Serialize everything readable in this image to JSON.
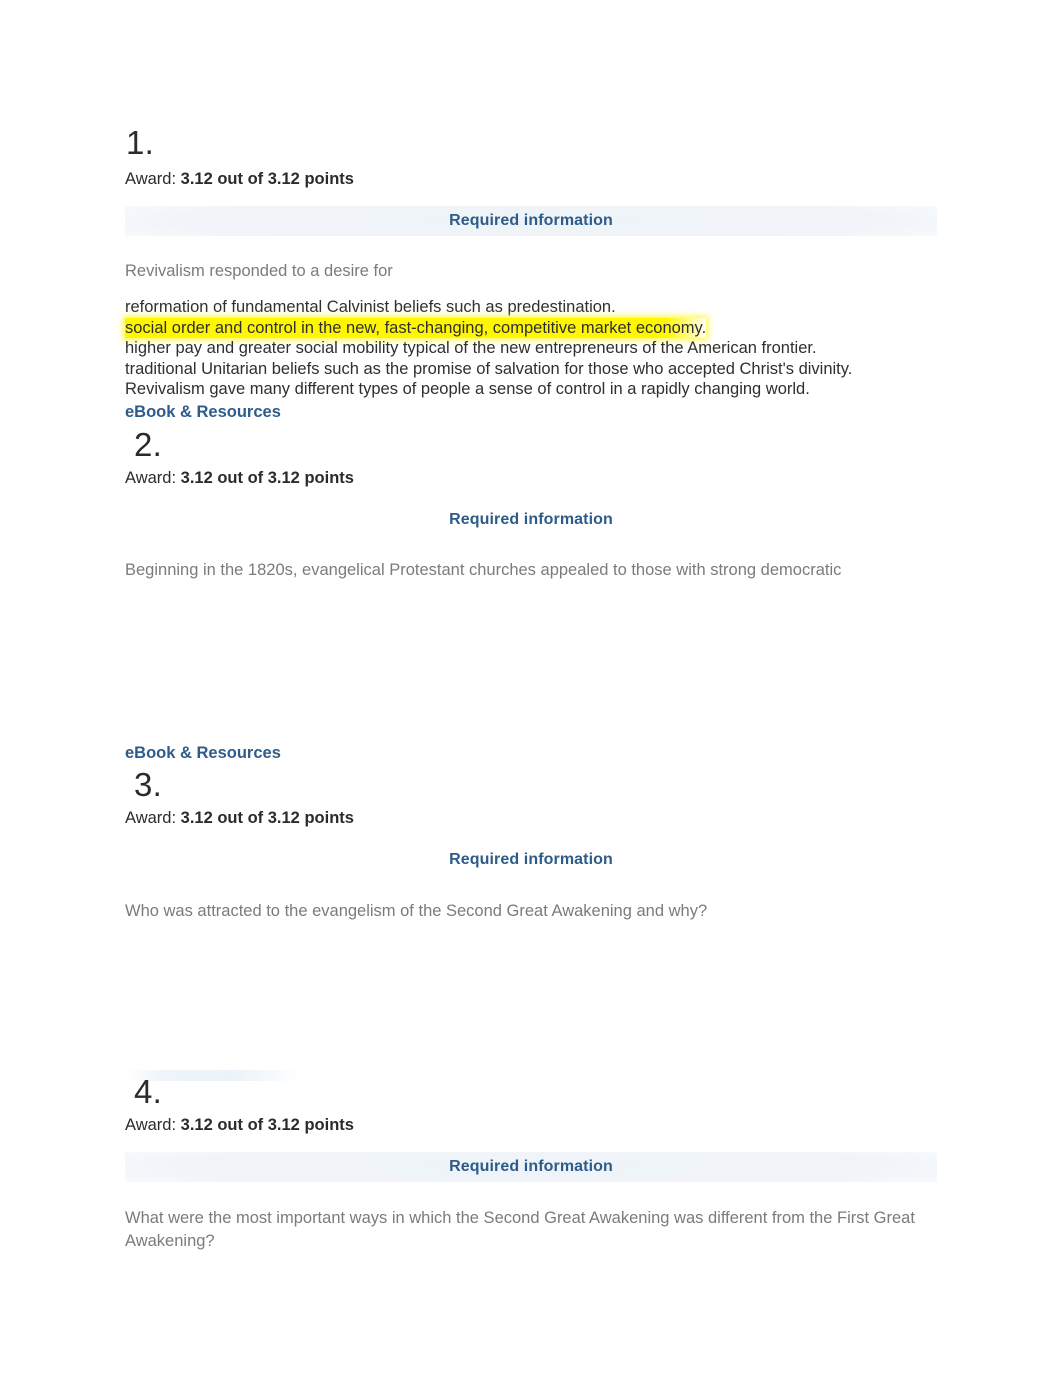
{
  "document": {
    "background_color": "#ffffff",
    "link_color": "#2e5c8a",
    "prompt_color": "#7b7b7b",
    "highlight_color": "#fff700"
  },
  "labels": {
    "award_label": "Award:",
    "required_information": "Required information",
    "ebook_resources": "eBook & Resources"
  },
  "questions": [
    {
      "number": "1.",
      "award_value": "3.12 out of 3.12 points",
      "required_information": "Required information",
      "prompt": "Revivalism responded to a desire for",
      "options": [
        {
          "text": "reformation of fundamental Calvinist beliefs such as predestination.",
          "highlighted": false
        },
        {
          "text": "social order and control in the new, fast-changing, competitive market economy.",
          "highlighted": true
        },
        {
          "text": "higher pay and greater social mobility typical of the new entrepreneurs of the American frontier.",
          "highlighted": false
        },
        {
          "text": "traditional Unitarian beliefs such as the promise of salvation for those who accepted Christ's divinity.",
          "highlighted": false
        },
        {
          "text": "Revivalism gave many different types of people a sense of control in a rapidly changing world.",
          "highlighted": false
        }
      ],
      "ebook_link": "eBook & Resources"
    },
    {
      "number": "2.",
      "award_value": "3.12 out of 3.12 points",
      "required_information": "Required information",
      "prompt": "Beginning in the 1820s, evangelical Protestant churches appealed to those with strong democratic",
      "options": [],
      "ebook_link": "eBook & Resources"
    },
    {
      "number": "3.",
      "award_value": "3.12 out of 3.12 points",
      "required_information": "Required information",
      "prompt": "Who was attracted to the evangelism of the Second Great Awakening and why?",
      "options": [],
      "ebook_link": null
    },
    {
      "number": "4.",
      "award_value": "3.12 out of 3.12 points",
      "required_information": "Required information",
      "prompt": "What were the most important ways in which the Second Great Awakening was different from the First Great Awakening?",
      "options": [],
      "ebook_link": null
    }
  ]
}
